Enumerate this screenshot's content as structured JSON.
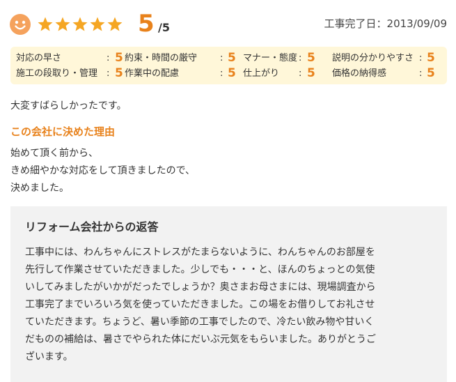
{
  "review": {
    "rating_value": 5,
    "score": "5",
    "score_max": "/5",
    "completion_date": "工事完了日：2013/09/09"
  },
  "ratings": [
    {
      "label": "対応の早さ",
      "value": "5"
    },
    {
      "label": "約束・時間の厳守",
      "value": "5"
    },
    {
      "label": "マナー・態度",
      "value": "5"
    },
    {
      "label": "説明の分かりやすさ",
      "value": "5"
    },
    {
      "label": "施工の段取り・管理",
      "value": "5"
    },
    {
      "label": "作業中の配慮",
      "value": "5"
    },
    {
      "label": "仕上がり",
      "value": "5"
    },
    {
      "label": "価格の納得感",
      "value": "5"
    }
  ],
  "colon": ":",
  "comment": "大変すばらしかったです。",
  "reason": {
    "title": "この会社に決めた理由",
    "lines": [
      "始めて頂く前から、",
      "きめ細やかな対応をして頂きましたので、",
      "決めました。"
    ]
  },
  "reply": {
    "title": "リフォーム会社からの返答",
    "lines": [
      "工事中には、わんちゃんにストレスがたまらないように、わんちゃんのお部屋を",
      "先行して作業させていただきました。少しでも・・・と、ほんのちょっとの気使",
      "いしてみましたがいかがだったでしょうか？奥さまお母さまには、現場調査から",
      "工事完了までいろいろ気を使っていただきました。この場をお借りしてお礼させ",
      "ていただきます。ちょうど、暑い季節の工事でしたので、冷たい飲み物や甘いく",
      "だものの補給は、暑さでやられた体にだいぶ元気をもらいました。ありがとうご",
      "ざいます。"
    ]
  },
  "colors": {
    "accent": "#e8821c",
    "star": "#f5a623",
    "ratings_bg": "#fff7d9",
    "reply_bg": "#f2f2f2"
  },
  "icons": {
    "smiley": "smiley-face-icon",
    "star": "star-icon"
  }
}
